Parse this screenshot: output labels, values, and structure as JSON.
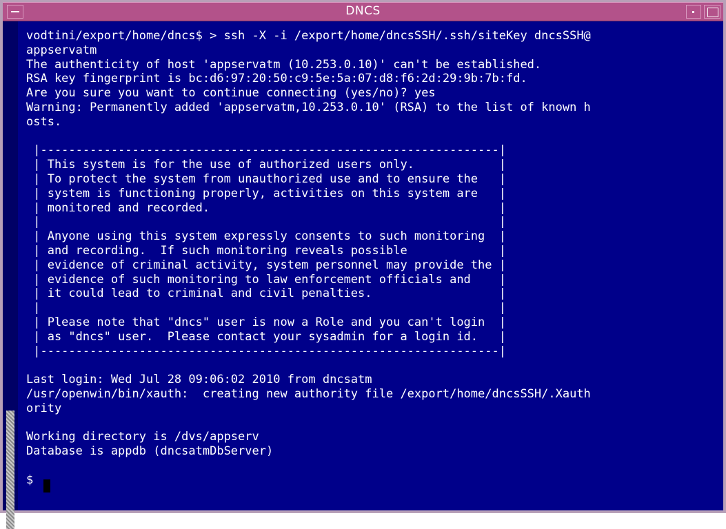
{
  "window": {
    "title": "DNCS"
  },
  "terminal": {
    "lines": [
      "vodtini/export/home/dncs$ > ssh -X -i /export/home/dncsSSH/.ssh/siteKey dncsSSH@",
      "appservatm",
      "The authenticity of host 'appservatm (10.253.0.10)' can't be established.",
      "RSA key fingerprint is bc:d6:97:20:50:c9:5e:5a:07:d8:f6:2d:29:9b:7b:fd.",
      "Are you sure you want to continue connecting (yes/no)? yes",
      "Warning: Permanently added 'appservatm,10.253.0.10' (RSA) to the list of known h",
      "osts.",
      "",
      " |-----------------------------------------------------------------|",
      " | This system is for the use of authorized users only.            |",
      " | To protect the system from unauthorized use and to ensure the   |",
      " | system is functioning properly, activities on this system are   |",
      " | monitored and recorded.                                         |",
      " |                                                                 |",
      " | Anyone using this system expressly consents to such monitoring  |",
      " | and recording.  If such monitoring reveals possible             |",
      " | evidence of criminal activity, system personnel may provide the |",
      " | evidence of such monitoring to law enforcement officials and    |",
      " | it could lead to criminal and civil penalties.                  |",
      " |                                                                 |",
      " | Please note that \"dncs\" user is now a Role and you can't login  |",
      " | as \"dncs\" user.  Please contact your sysadmin for a login id.   |",
      " |-----------------------------------------------------------------|",
      "",
      "Last login: Wed Jul 28 09:06:02 2010 from dncsatm",
      "/usr/openwin/bin/xauth:  creating new authority file /export/home/dncsSSH/.Xauth",
      "ority",
      "",
      "Working directory is /dvs/appserv",
      "Database is appdb (dncsatmDbServer)",
      "",
      "$ "
    ]
  }
}
